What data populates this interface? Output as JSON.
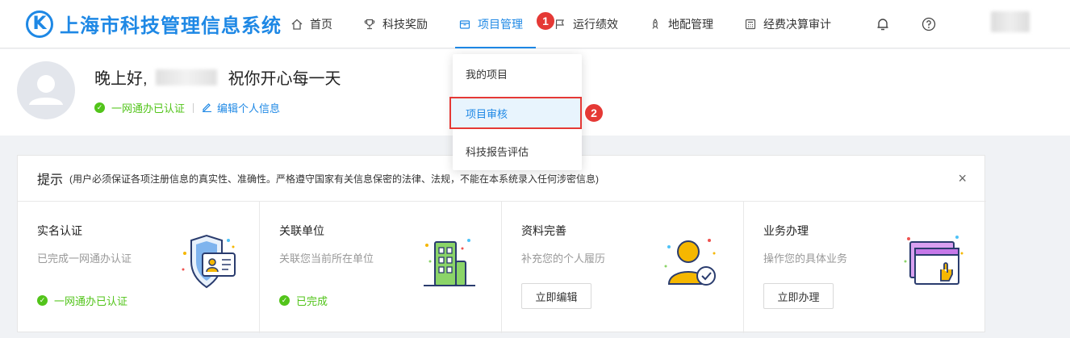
{
  "app": {
    "logo_letter": "K",
    "title": "上海市科技管理信息系统"
  },
  "nav": [
    {
      "label": "首页",
      "icon": "home-icon"
    },
    {
      "label": "科技奖励",
      "icon": "trophy-icon"
    },
    {
      "label": "项目管理",
      "icon": "folder-icon",
      "active": true
    },
    {
      "label": "运行绩效",
      "icon": "flag-icon"
    },
    {
      "label": "地配管理",
      "icon": "rocket-icon"
    },
    {
      "label": "经费决算审计",
      "icon": "calculator-icon"
    }
  ],
  "badges": {
    "one": "1",
    "two": "2"
  },
  "dropdown": {
    "items": [
      "我的项目",
      "项目审核",
      "科技报告评估"
    ]
  },
  "welcome": {
    "greeting": "晚上好,",
    "wish": "祝你开心每一天",
    "verified": "一网通办已认证",
    "edit": "编辑个人信息"
  },
  "notice": {
    "title": "提示",
    "text": "(用户必须保证各项注册信息的真实性、准确性。严格遵守国家有关信息保密的法律、法规，不能在本系统录入任何涉密信息)",
    "close": "×"
  },
  "tiles": [
    {
      "title": "实名认证",
      "desc": "已完成一网通办认证",
      "status": "一网通办已认证"
    },
    {
      "title": "关联单位",
      "desc": "关联您当前所在单位",
      "status": "已完成"
    },
    {
      "title": "资料完善",
      "desc": "补充您的个人履历",
      "button": "立即编辑"
    },
    {
      "title": "业务办理",
      "desc": "操作您的具体业务",
      "button": "立即办理"
    }
  ],
  "colors": {
    "accent": "#1e88e5",
    "success": "#52c41a",
    "annotation": "#e53935"
  }
}
